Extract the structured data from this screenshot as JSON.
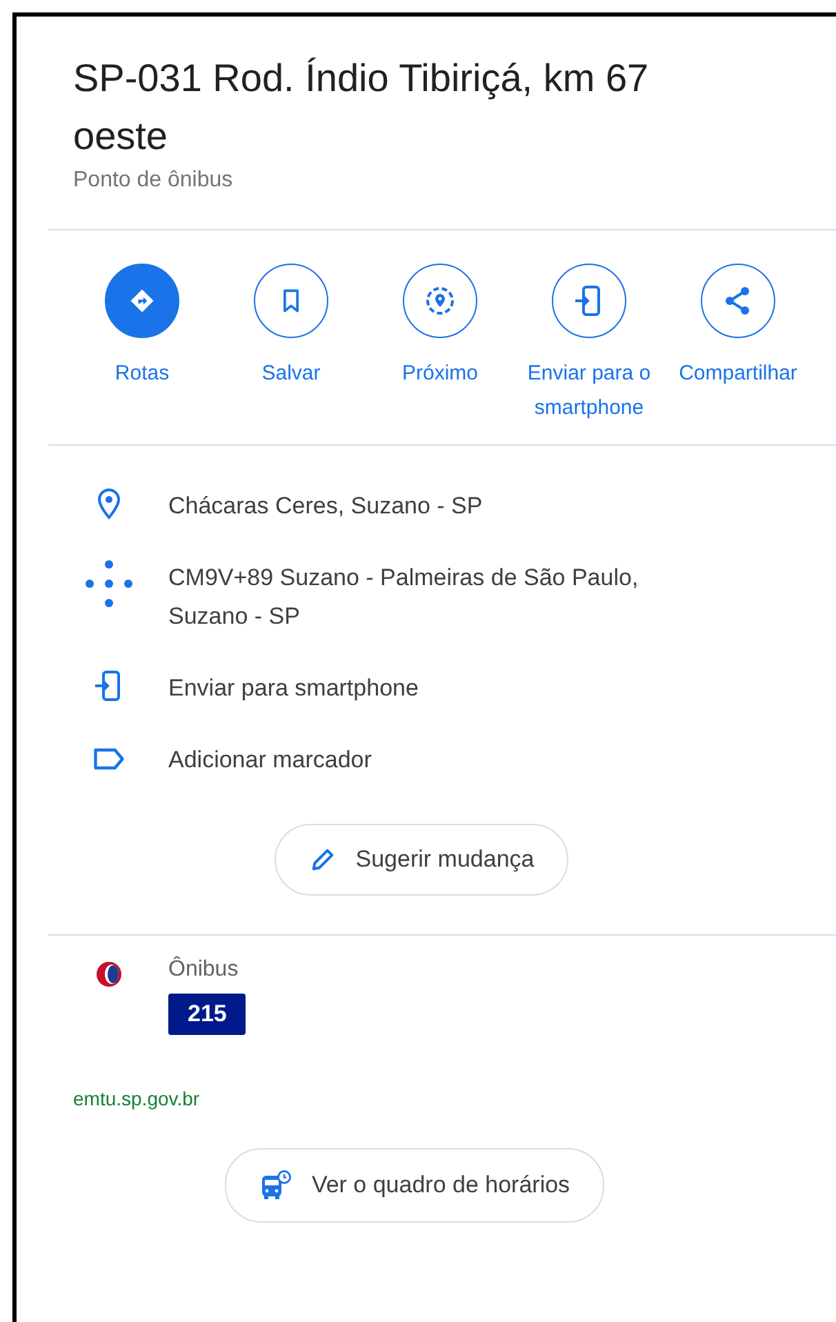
{
  "place": {
    "title": "SP-031 Rod. Índio Tibiriçá, km 67 oeste",
    "category": "Ponto de ônibus"
  },
  "actions": [
    {
      "label": "Rotas",
      "kind": "directions"
    },
    {
      "label": "Salvar",
      "kind": "save"
    },
    {
      "label": "Próximo",
      "kind": "nearby"
    },
    {
      "label": "Enviar para o smartphone",
      "kind": "send"
    },
    {
      "label": "Compartilhar",
      "kind": "share"
    }
  ],
  "details": [
    {
      "text": "Chácaras Ceres, Suzano - SP",
      "kind": "pin"
    },
    {
      "text": "CM9V+89 Suzano - Palmeiras de São Paulo, Suzano - SP",
      "kind": "pluscode"
    },
    {
      "text": "Enviar para smartphone",
      "kind": "send"
    },
    {
      "text": "Adicionar marcador",
      "kind": "label"
    }
  ],
  "suggest_button": "Sugerir mudança",
  "transit": {
    "mode": "Ônibus",
    "lines": [
      "215"
    ],
    "agency_link": "emtu.sp.gov.br",
    "schedule_button": "Ver o quadro de horários"
  }
}
